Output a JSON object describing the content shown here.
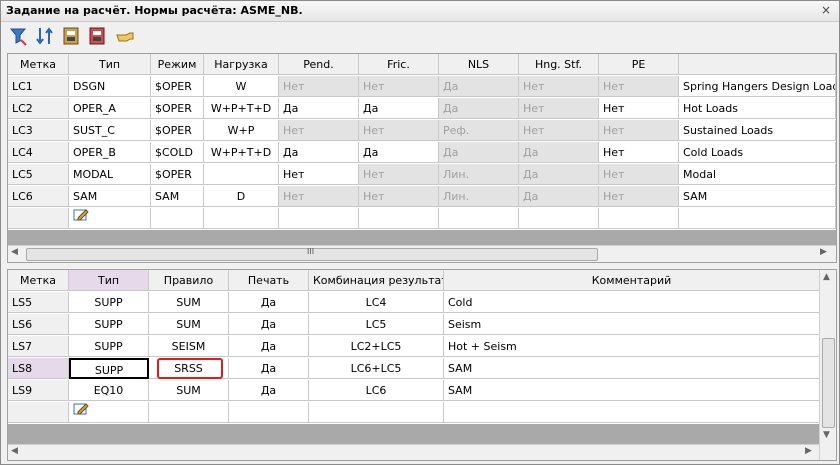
{
  "title": "Задание на расчёт. Нормы расчёта: ASME_NB.",
  "close_icon": "×",
  "toolbar": [
    "filter-icon",
    "sort-icon",
    "print-icon",
    "print2-icon",
    "hand-pointer-icon"
  ],
  "cases": {
    "headers": [
      "Метка",
      "Тип",
      "Режим",
      "Нагрузка",
      "Pend.",
      "Fric.",
      "NLS",
      "Hng. Stf.",
      "PE",
      ""
    ],
    "rows": [
      [
        "LC1",
        "DSGN",
        "$OPER",
        "W",
        "Нет",
        "Нет",
        "Да",
        "Нет",
        "Нет",
        "Spring Hangers Design Loads"
      ],
      [
        "LC2",
        "OPER_A",
        "$OPER",
        "W+P+T+D",
        "Да",
        "Да",
        "Да",
        "Нет",
        "Нет",
        "Hot Loads"
      ],
      [
        "LC3",
        "SUST_C",
        "$OPER",
        "W+P",
        "Нет",
        "Нет",
        "Реф.",
        "Нет",
        "Нет",
        "Sustained Loads"
      ],
      [
        "LC4",
        "OPER_B",
        "$COLD",
        "W+P+T+D",
        "Да",
        "Да",
        "Да",
        "Да",
        "Нет",
        "Cold Loads"
      ],
      [
        "LC5",
        "MODAL",
        "$OPER",
        "",
        "Нет",
        "Нет",
        "Лин.",
        "Да",
        "Нет",
        "Modal"
      ],
      [
        "LC6",
        "SAM",
        "SAM",
        "D",
        "Нет",
        "Нет",
        "Лин.",
        "Да",
        "Нет",
        "SAM"
      ]
    ]
  },
  "combos": {
    "headers": [
      "Метка",
      "Тип",
      "Правило",
      "Печать",
      "Комбинация результатов",
      "Комментарий"
    ],
    "rows": [
      [
        "LS5",
        "SUPP",
        "SUM",
        "Да",
        "LC4",
        "Cold"
      ],
      [
        "LS6",
        "SUPP",
        "SUM",
        "Да",
        "LC5",
        "Seism"
      ],
      [
        "LS7",
        "SUPP",
        "SEISM",
        "Да",
        "LC2+LC5",
        "Hot + Seism"
      ],
      [
        "LS8",
        "SUPP",
        "SRSS",
        "Да",
        "LC6+LC5",
        "SAM"
      ],
      [
        "LS9",
        "EQ10",
        "SUM",
        "Да",
        "LC6",
        "SAM"
      ]
    ]
  },
  "scroll_glyph": "III"
}
